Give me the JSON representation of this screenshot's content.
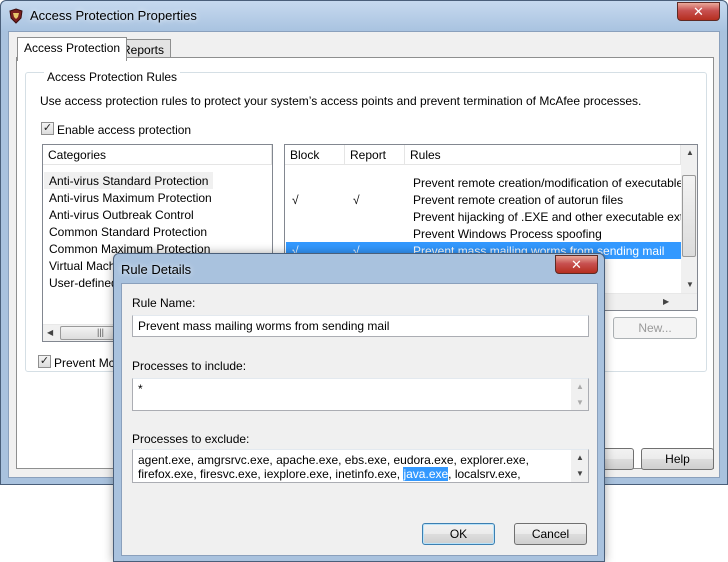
{
  "window": {
    "title": "Access Protection Properties",
    "close_glyph": "✕",
    "tabs": [
      {
        "label": "Access Protection",
        "active": true
      },
      {
        "label": "Reports",
        "active": false
      }
    ],
    "group_title": "Access Protection Rules",
    "description": "Use access protection rules to protect your system’s access points and prevent termination of McAfee processes.",
    "enable_checkbox": {
      "label": "Enable access protection",
      "checked": true,
      "mark": "✓"
    },
    "prevent_checkbox": {
      "label": "Prevent McAfe",
      "checked": true,
      "mark": "✓"
    },
    "categories": {
      "header": "Categories",
      "items": [
        "Anti-virus Standard Protection",
        "Anti-virus Maximum Protection",
        "Anti-virus Outbreak Control",
        "Common Standard Protection",
        "Common Maximum Protection",
        "Virtual Machin",
        "User-defined R"
      ],
      "selected_index": 0
    },
    "rules": {
      "headers": {
        "block": "Block",
        "report": "Report",
        "rules": "Rules"
      },
      "rows": [
        {
          "block": "",
          "report": "",
          "rule": "Prevent remote creation/modification of executable and"
        },
        {
          "block": "√",
          "report": "√",
          "rule": "Prevent remote creation of autorun files"
        },
        {
          "block": "",
          "report": "",
          "rule": "Prevent hijacking of .EXE and other executable extensio"
        },
        {
          "block": "",
          "report": "",
          "rule": "Prevent Windows Process spoofing"
        },
        {
          "block": "√",
          "report": "√",
          "rule": "Prevent mass mailing worms from sending mail"
        }
      ],
      "selected_index": 4
    },
    "buttons": {
      "new": "New...",
      "help": "Help"
    },
    "scroll_glyphs": {
      "left": "◀",
      "right": "▶",
      "up": "▲",
      "down": "▼",
      "grip": "|||"
    },
    "colors": {
      "selection": "#3399ff",
      "title_bar": "#a9c2de",
      "close": "#c75050"
    }
  },
  "dialog": {
    "title": "Rule Details",
    "close_glyph": "✕",
    "rule_name_label": "Rule Name:",
    "rule_name_value": "Prevent mass mailing worms from sending mail",
    "include_label": "Processes to include:",
    "include_value": "*",
    "exclude_label": "Processes to exclude:",
    "exclude_line1": "agent.exe, amgrsrvc.exe, apache.exe, ebs.exe, eudora.exe, explorer.exe,",
    "exclude_line2_before": "firefox.exe, firesvc.exe, iexplore.exe, inetinfo.exe, ",
    "exclude_line2_highlight": "java.exe",
    "exclude_line2_after": ", localsrv.exe,",
    "ok_label": "OK",
    "cancel_label": "Cancel"
  }
}
